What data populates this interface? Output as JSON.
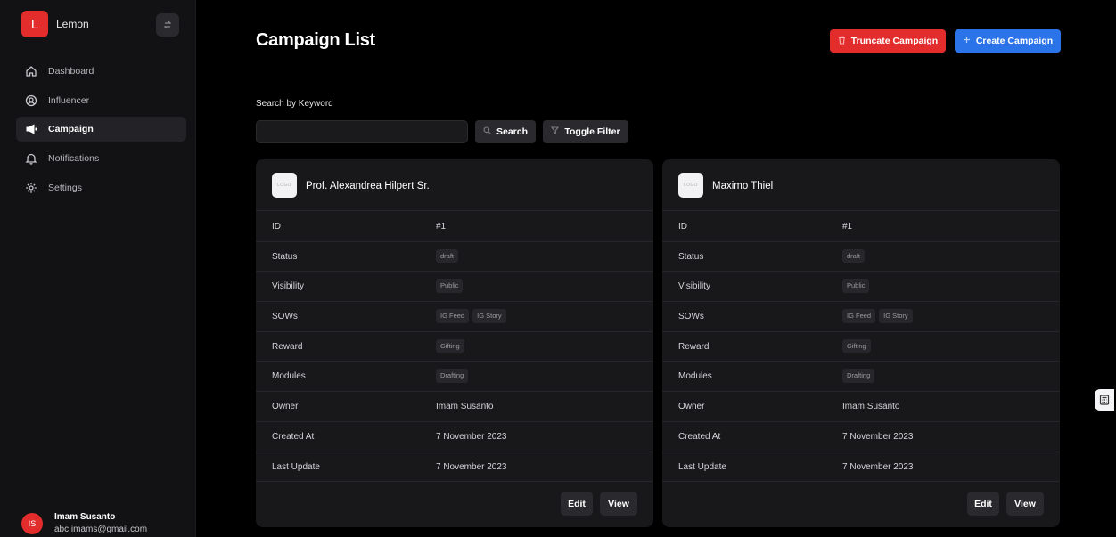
{
  "app": {
    "brand_initial": "L",
    "brand_name": "Lemon"
  },
  "sidebar": {
    "items": [
      {
        "label": "Dashboard",
        "icon": "home-icon",
        "active": false
      },
      {
        "label": "Influencer",
        "icon": "user-circle-icon",
        "active": false
      },
      {
        "label": "Campaign",
        "icon": "megaphone-icon",
        "active": true
      },
      {
        "label": "Notifications",
        "icon": "bell-icon",
        "active": false
      },
      {
        "label": "Settings",
        "icon": "gear-icon",
        "active": false
      }
    ]
  },
  "user": {
    "initials": "IS",
    "name": "Imam Susanto",
    "email": "abc.imams@gmail.com"
  },
  "header": {
    "title": "Campaign List",
    "truncate_label": "Truncate Campaign",
    "create_label": "Create Campaign"
  },
  "search": {
    "label": "Search by Keyword",
    "value": "",
    "placeholder": "",
    "search_label": "Search",
    "filter_label": "Toggle Filter"
  },
  "row_labels": {
    "id": "ID",
    "status": "Status",
    "visibility": "Visibility",
    "sows": "SOWs",
    "reward": "Reward",
    "modules": "Modules",
    "owner": "Owner",
    "created_at": "Created At",
    "last_update": "Last Update"
  },
  "card_actions": {
    "edit": "Edit",
    "view": "View"
  },
  "campaigns": [
    {
      "logo_text": "LOGO",
      "name": "Prof. Alexandrea Hilpert Sr.",
      "id": "#1",
      "status": "draft",
      "visibility": "Public",
      "sows": [
        "IG Feed",
        "IG Story"
      ],
      "reward": "Gifting",
      "modules": "Drafting",
      "owner": "Imam Susanto",
      "created_at": "7 November 2023",
      "last_update": "7 November 2023"
    },
    {
      "logo_text": "LOGO",
      "name": "Maximo Thiel",
      "id": "#1",
      "status": "draft",
      "visibility": "Public",
      "sows": [
        "IG Feed",
        "IG Story"
      ],
      "reward": "Gifting",
      "modules": "Drafting",
      "owner": "Imam Susanto",
      "created_at": "7 November 2023",
      "last_update": "7 November 2023"
    }
  ],
  "colors": {
    "accent_red": "#e32c2c",
    "accent_blue": "#2a73e8",
    "background": "#000000",
    "card": "#18181b"
  }
}
